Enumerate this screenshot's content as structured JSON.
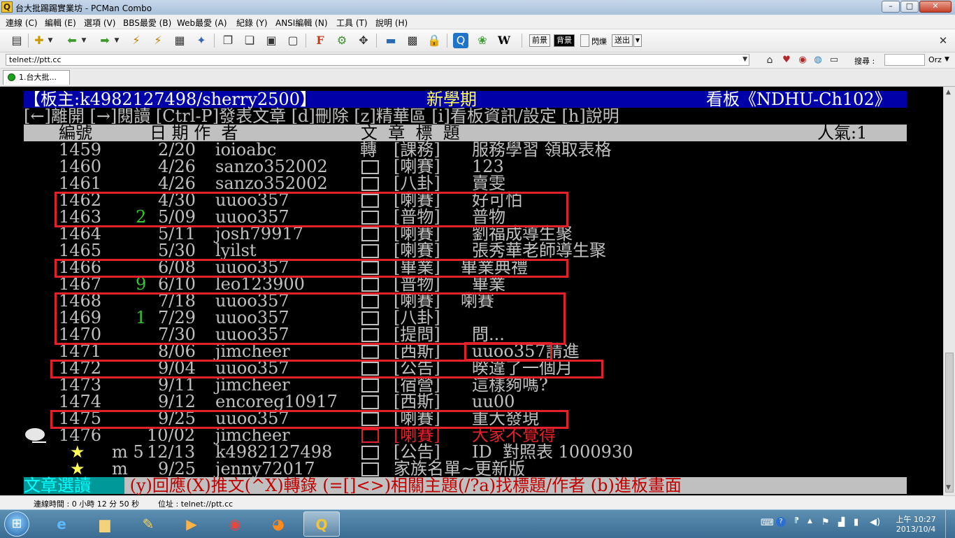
{
  "window": {
    "title": "台大批踢踢實業坊 - PCMan Combo",
    "app_icon_glyph": "Q",
    "controls": [
      "–",
      "□",
      "✕"
    ]
  },
  "menu": [
    "連線 (C)",
    "編輯 (E)",
    "選項 (V)",
    "BBS最愛 (B)",
    "Web最愛 (A)",
    "紀錄 (Y)",
    "ANSI編輯 (N)",
    "工具 (T)",
    "說明 (H)"
  ],
  "toolbar": {
    "fg_label": "前景",
    "bg_label": "背景",
    "blink_label": "閃爍",
    "send_label": "送出",
    "wiki_glyph": "W",
    "font_glyph": "F",
    "close_glyph": "✕"
  },
  "address": {
    "value": "telnet://ptt.cc",
    "search_label": "搜尋 :",
    "search_value": "",
    "engine": "Orz"
  },
  "tab": {
    "label": "1.台大批..."
  },
  "terminal": {
    "header": {
      "moderator": "【板主:k4982127498/sherry2500】",
      "center": "新學期",
      "board": "看板《NDHU-Ch102》"
    },
    "help_line": "[←]離開 [→]閱讀 [Ctrl-P]發表文章 [d]刪除 [z]精華區 [i]看板資訊/設定 [h]說明",
    "columns": {
      "number": "編號",
      "date_author": "日 期 作  者",
      "title": "文  章  標  題",
      "popularity": "人氣:1"
    },
    "rows": [
      {
        "num": "1459",
        "push": "",
        "date": "2/20",
        "author": "ioioabc",
        "mark": "轉",
        "cat": "[課務]",
        "title": "服務學習 領取表格"
      },
      {
        "num": "1460",
        "push": "",
        "date": "4/26",
        "author": "sanzo352002",
        "mark": "",
        "cat": "[喇賽]",
        "title": "123"
      },
      {
        "num": "1461",
        "push": "",
        "date": "4/26",
        "author": "sanzo352002",
        "mark": "",
        "cat": "[八卦]",
        "title": "賣雯"
      },
      {
        "num": "1462",
        "push": "",
        "date": "4/30",
        "author": "uuoo357",
        "mark": "",
        "cat": "[喇賽]",
        "title": "好可怕"
      },
      {
        "num": "1463",
        "push": "2",
        "date": "5/09",
        "author": "uuoo357",
        "mark": "",
        "cat": "[普物]",
        "title": "普物"
      },
      {
        "num": "1464",
        "push": "",
        "date": "5/11",
        "author": "josh79917",
        "mark": "",
        "cat": "[喇賽]",
        "title": "劉福成導生聚"
      },
      {
        "num": "1465",
        "push": "",
        "date": "5/30",
        "author": "lyilst",
        "mark": "",
        "cat": "[喇賽]",
        "title": "張秀華老師導生聚"
      },
      {
        "num": "1466",
        "push": "",
        "date": "6/08",
        "author": "uuoo357",
        "mark": "",
        "cat": "[畢業]",
        "title": "畢業典禮"
      },
      {
        "num": "1467",
        "push": "9",
        "date": "6/10",
        "author": "leo123900",
        "mark": "",
        "cat": "[普物]",
        "title": "畢業"
      },
      {
        "num": "1468",
        "push": "",
        "date": "7/18",
        "author": "uuoo357",
        "mark": "",
        "cat": "[喇賽]",
        "title": "喇賽"
      },
      {
        "num": "1469",
        "push": "1",
        "date": "7/29",
        "author": "uuoo357",
        "mark": "",
        "cat": "[八卦]",
        "title": ""
      },
      {
        "num": "1470",
        "push": "",
        "date": "7/30",
        "author": "uuoo357",
        "mark": "",
        "cat": "[提問]",
        "title": "問..."
      },
      {
        "num": "1471",
        "push": "",
        "date": "8/06",
        "author": "jimcheer",
        "mark": "",
        "cat": "[西斯]",
        "title": "uuoo357請進"
      },
      {
        "num": "1472",
        "push": "",
        "date": "9/04",
        "author": "uuoo357",
        "mark": "",
        "cat": "[公告]",
        "title": "暌違了一個月"
      },
      {
        "num": "1473",
        "push": "",
        "date": "9/11",
        "author": "jimcheer",
        "mark": "",
        "cat": "[宿營]",
        "title": "這樣夠嗎?"
      },
      {
        "num": "1474",
        "push": "",
        "date": "9/12",
        "author": "encoreg10917",
        "mark": "",
        "cat": "[西斯]",
        "title": "uu00"
      },
      {
        "num": "1475",
        "push": "",
        "date": "9/25",
        "author": "uuoo357",
        "mark": "",
        "cat": "[喇賽]",
        "title": "重大發現"
      },
      {
        "num": "1476",
        "push": "",
        "date": "10/02",
        "author": "jimcheer",
        "mark": "",
        "cat": "[喇賽]",
        "title": "大家不覺得"
      },
      {
        "num": "★",
        "push": "m 5",
        "date": "12/13",
        "author": "k4982127498",
        "mark": "",
        "cat": "[公告]",
        "title": "ID  對照表 1000930"
      },
      {
        "num": "★",
        "push": "m",
        "date": "9/25",
        "author": "jenny72017",
        "mark": "",
        "cat": "",
        "title": "家族名單~更新版"
      }
    ],
    "footer": {
      "mode": "文章選讀",
      "help": " (y)回應(X)推文(^X)轉錄 (=[]<>)相關主題(/?a)找標題/作者 (b)進板畫面"
    }
  },
  "status": {
    "conn_time": "連線時間 : 0 小時 12 分 50 秒",
    "location": "位址 : telnet://ptt.cc"
  },
  "taskbar": {
    "clock_time": "上午 10:27",
    "clock_date": "2013/10/4"
  },
  "colors": {
    "term_bg": "#000000",
    "term_fg": "#c0c0c0",
    "header_bg": "#0000a8",
    "header_fg": "#ffffff",
    "title_fg": "#ffff55",
    "gray_bar": "#c0c0c0",
    "push_green": "#32c832",
    "highlight_red": "#e4202a",
    "footer_cyan": "#009999",
    "footer_red": "#c00000"
  }
}
